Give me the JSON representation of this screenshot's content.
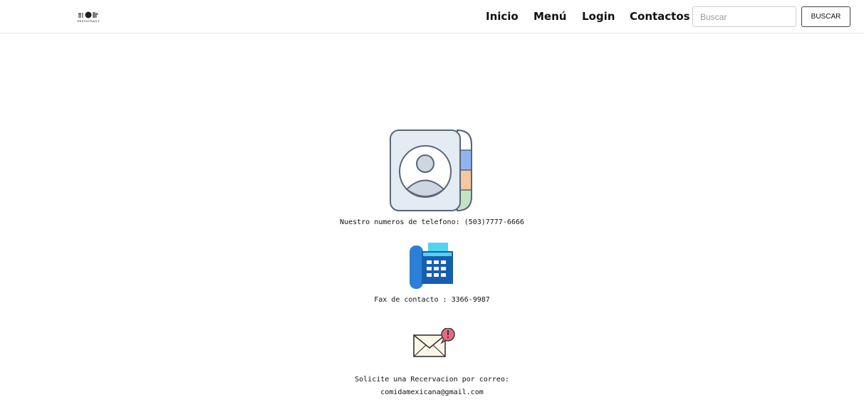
{
  "header": {
    "logo": {
      "text": "RESTAURANT"
    },
    "nav": [
      {
        "id": "inicio",
        "label": "Inicio"
      },
      {
        "id": "menu",
        "label": "Menú"
      },
      {
        "id": "login",
        "label": "Login"
      },
      {
        "id": "contactos",
        "label": "Contactos"
      }
    ],
    "search": {
      "placeholder": "Buscar",
      "button_label": "BUSCAR"
    }
  },
  "contact": {
    "phone_text": "Nuestro numeros de telefono: (503)7777-6666",
    "fax_text": "Fax de contacto : 3366-9987",
    "email_label": "Solicite una Recervacion por correo:",
    "email_address": "comidamexicana@gmail.com"
  },
  "icons": {
    "address_book": "address-book-icon",
    "fax": "fax-machine-icon",
    "mail": "mail-notification-icon"
  },
  "colors": {
    "tab_blue": "#8fb4f0",
    "tab_orange": "#f8c6a0",
    "tab_green": "#c2e4c2",
    "fax_blue": "#2b7fd6",
    "fax_cyan": "#52d4f0",
    "mail_alert": "#e66b7f"
  }
}
